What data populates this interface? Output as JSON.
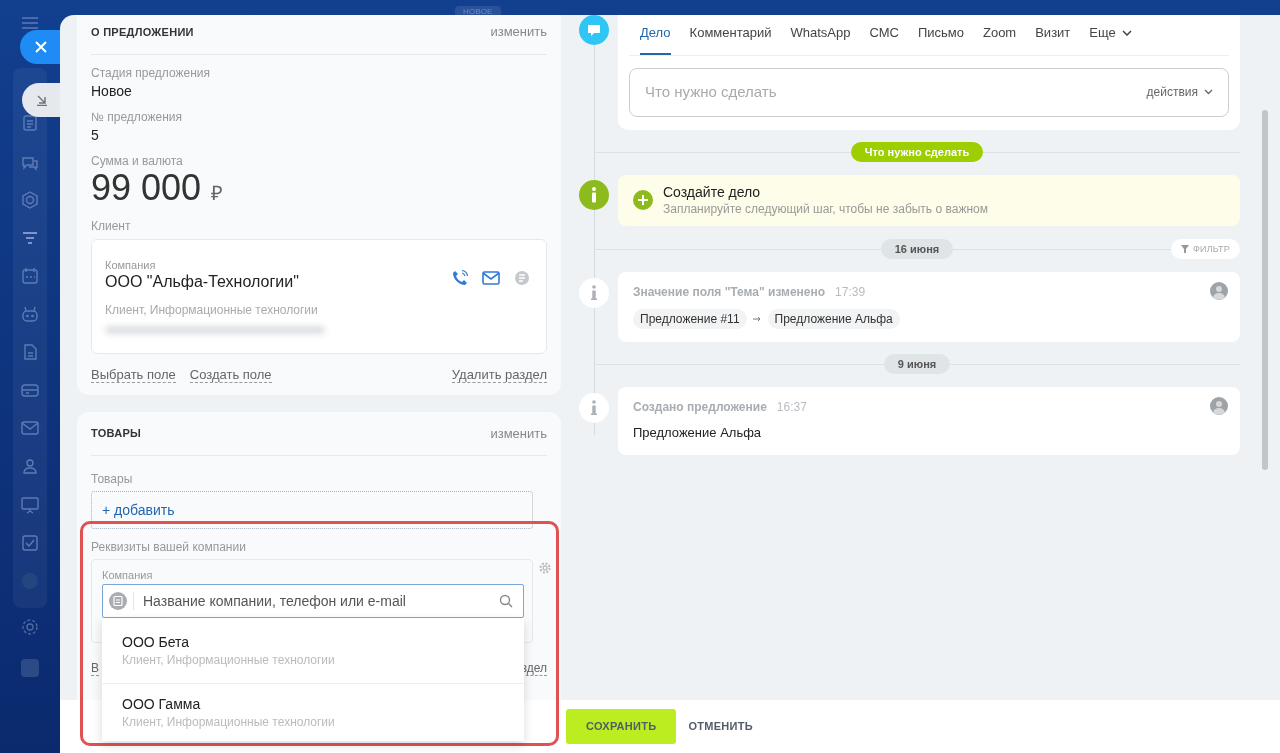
{
  "top_badge": "НОВОЕ",
  "about": {
    "title": "О ПРЕДЛОЖЕНИИ",
    "edit": "изменить",
    "fields": [
      {
        "label": "Стадия предложения",
        "value": "Новое"
      },
      {
        "label": "№ предложения",
        "value": "5"
      }
    ],
    "amount": {
      "label": "Сумма и валюта",
      "value": "99 000",
      "currency": "₽"
    },
    "client": {
      "label": "Клиент",
      "company_label": "Компания",
      "name": "ООО \"Альфа-Технологии\"",
      "details": "Клиент, Информационные технологии"
    },
    "links": [
      "Выбрать поле",
      "Создать поле"
    ],
    "delete": "Удалить раздел"
  },
  "products": {
    "title": "ТОВАРЫ",
    "edit": "изменить",
    "label": "Товары",
    "add": "+ добавить"
  },
  "requisites": {
    "label": "Реквизиты вашей компании",
    "company_label": "Компания",
    "search": {
      "placeholder": "Название компании, телефон или e-mail"
    },
    "link_left": "В",
    "link_right": "здел",
    "suggestions": [
      {
        "name": "ООО Бета",
        "details": "Клиент, Информационные технологии"
      },
      {
        "name": "ООО Гамма",
        "details": "Клиент, Информационные технологии"
      }
    ]
  },
  "timeline": {
    "tabs": [
      {
        "label": "Дело",
        "selected": true
      },
      {
        "label": "Комментарий",
        "selected": false
      },
      {
        "label": "WhatsApp",
        "selected": false
      },
      {
        "label": "СМС",
        "selected": false
      },
      {
        "label": "Письмо",
        "selected": false
      },
      {
        "label": "Zoom",
        "selected": false
      },
      {
        "label": "Визит",
        "selected": false
      },
      {
        "label": "Еще",
        "selected": false
      }
    ],
    "task_input": {
      "placeholder": "Что нужно сделать"
    },
    "actions": "действия",
    "todo_badge": "Что нужно сделать",
    "create": {
      "title": "Создайте дело",
      "hint": "Запланируйте следующий шаг, чтобы не забыть о важном"
    },
    "filter": "ФИЛЬТР",
    "groups": [
      {
        "date": "16 июня",
        "events": [
          {
            "kind": "change",
            "title": "Значение поля \"Тема\" изменено",
            "time": "17:39",
            "from": "Предложение #11",
            "to": "Предложение Альфа"
          }
        ]
      },
      {
        "date": "9 июня",
        "events": [
          {
            "kind": "created",
            "title": "Создано предложение",
            "time": "16:37",
            "text": "Предложение Альфа"
          }
        ]
      }
    ]
  },
  "buttons": {
    "save": "СОХРАНИТЬ",
    "cancel": "ОТМЕНИТЬ"
  }
}
